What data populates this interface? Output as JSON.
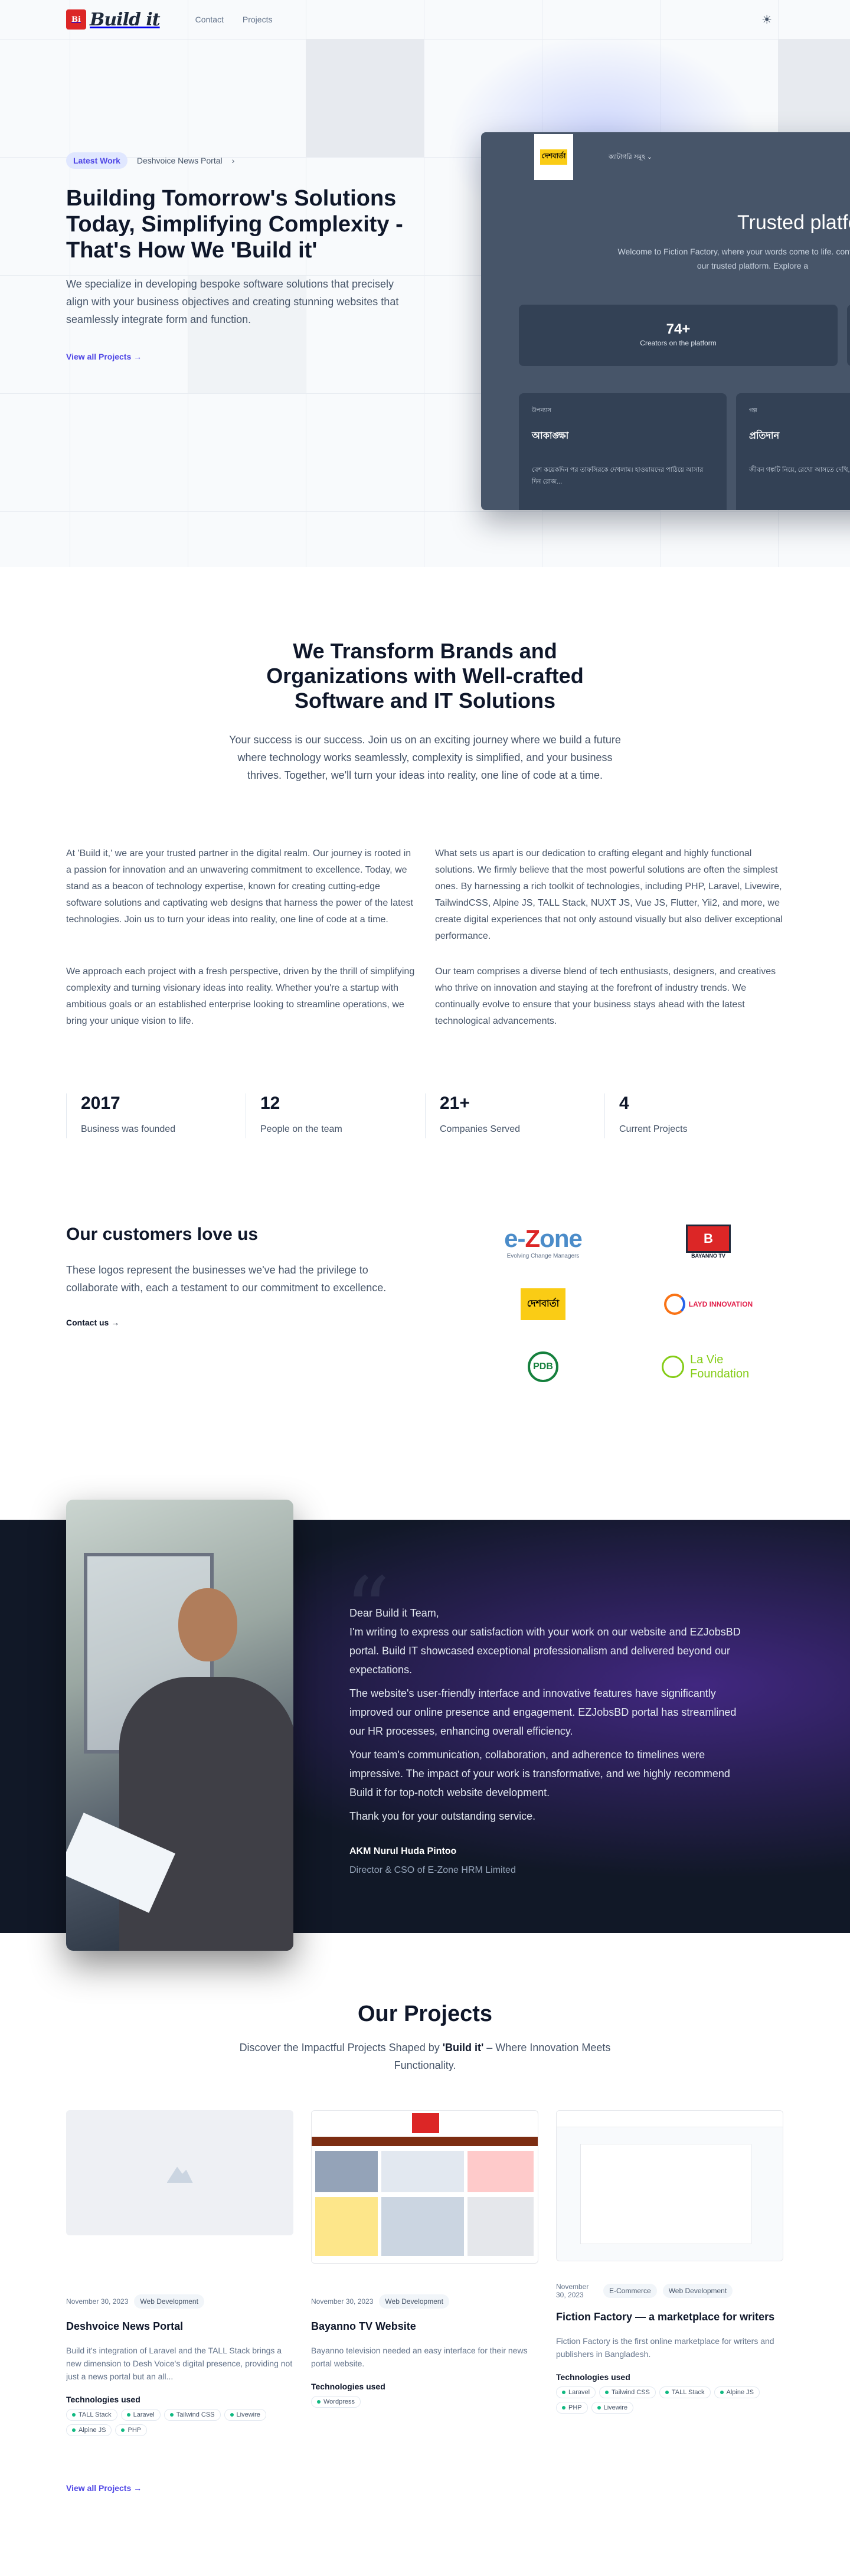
{
  "nav": {
    "logo_mark": "Bi",
    "logo_text": "Build it",
    "links": [
      "Contact",
      "Projects"
    ],
    "theme_icon": "☀"
  },
  "hero": {
    "pill": "Latest Work",
    "pill_link": "Deshvoice News Portal",
    "title": "Building Tomorrow's Solutions Today, Simplifying Complexity - That's How We 'Build it'",
    "description": "We specialize in developing bespoke software solutions that precisely align with your business objectives and creating stunning websites that seamlessly integrate form and function.",
    "cta": "View all Projects →",
    "mock": {
      "logo_text": "দেশবার্তা",
      "nav_text": "ক্যাটাগরি সমূহ ⌄",
      "title": "Trusted platform",
      "subtitle": "Welcome to Fiction Factory, where your words come to life. confidence on our trusted platform. Explore a",
      "stat_value": "74+",
      "stat_label": "Creators on the platform",
      "cards": [
        {
          "tag": "উপন্যাস",
          "title": "আকাঙ্ক্ষা",
          "text": "বেশ কয়েকদিন পর তাফসিরকে দেখলাম। হাওয়ায়দের পাঠিয়ে আসার দিন রোজ..."
        },
        {
          "tag": "গল্প",
          "title": "প্রতিদান",
          "text": "জীবন গল্পটি নিয়ে, রেখো আসতে দেখি, ওবোদের ঘুরতে সুরুজ"
        }
      ]
    }
  },
  "transform": {
    "title": "We Transform Brands and Organizations with Well-crafted Software and IT Solutions",
    "subtitle": "Your success is our success. Join us on an exciting journey where we build a future where technology works seamlessly, complexity is simplified, and your business thrives. Together, we'll turn your ideas into reality, one line of code at a time.",
    "paragraphs": [
      "At 'Build it,' we are your trusted partner in the digital realm. Our journey is rooted in a passion for innovation and an unwavering commitment to excellence. Today, we stand as a beacon of technology expertise, known for creating cutting-edge software solutions and captivating web designs that harness the power of the latest technologies. Join us to turn your ideas into reality, one line of code at a time.",
      "What sets us apart is our dedication to crafting elegant and highly functional solutions. We firmly believe that the most powerful solutions are often the simplest ones. By harnessing a rich toolkit of technologies, including PHP, Laravel, Livewire, TailwindCSS, Alpine JS, TALL Stack, NUXT JS, Vue JS, Flutter, Yii2, and more, we create digital experiences that not only astound visually but also deliver exceptional performance.",
      "We approach each project with a fresh perspective, driven by the thrill of simplifying complexity and turning visionary ideas into reality. Whether you're a startup with ambitious goals or an established enterprise looking to streamline operations, we bring your unique vision to life.",
      "Our team comprises a diverse blend of tech enthusiasts, designers, and creatives who thrive on innovation and staying at the forefront of industry trends. We continually evolve to ensure that your business stays ahead with the latest technological advancements."
    ]
  },
  "stats": [
    {
      "value": "2017",
      "label": "Business was founded"
    },
    {
      "value": "12",
      "label": "People on the team"
    },
    {
      "value": "21+",
      "label": "Companies Served"
    },
    {
      "value": "4",
      "label": "Current Projects"
    }
  ],
  "customers": {
    "title": "Our customers love us",
    "description": "These logos represent the businesses we've had the privilege to collaborate with, each a testament to our commitment to excellence.",
    "cta": "Contact us →",
    "logos": {
      "ezone_a": "e-",
      "ezone_b": "Z",
      "ezone_c": "one",
      "ezone_tag": "Evolving Change Managers",
      "bayanno": "B",
      "bayanno_sub": "BAYANNO TV",
      "desh": "দেশবার্তা",
      "layd": "LAYD INNOVATION",
      "pdb": "PDB",
      "lavie": "La Vie Foundation"
    }
  },
  "testimonial": {
    "quote_mark": "“",
    "paragraphs": [
      "Dear Build it Team,",
      "I'm writing to express our satisfaction with your work on our website and EZJobsBD portal. Build IT showcased exceptional professionalism and delivered beyond our expectations.",
      "The website's user-friendly interface and innovative features have significantly improved our online presence and engagement. EZJobsBD portal has streamlined our HR processes, enhancing overall efficiency.",
      "Your team's communication, collaboration, and adherence to timelines were impressive. The impact of your work is transformative, and we highly recommend Build it for top-notch website development.",
      "Thank you for your outstanding service."
    ],
    "author": "AKM Nurul Huda Pintoo",
    "role": "Director & CSO of E-Zone HRM Limited"
  },
  "projects": {
    "title": "Our Projects",
    "subtitle_before": "Discover the Impactful Projects Shaped by ",
    "subtitle_brand": "'Build it'",
    "subtitle_after": " – Where Innovation Meets Functionality.",
    "tech_label": "Technologies used",
    "items": [
      {
        "date": "November 30, 2023",
        "tags": [
          "Web Development"
        ],
        "title": "Deshvoice News Portal",
        "description": "Build it's integration of Laravel and the TALL Stack brings a new dimension to Desh Voice's digital presence, providing not just a news portal but an all...",
        "techs": [
          "TALL Stack",
          "Laravel",
          "Tailwind CSS",
          "Livewire",
          "Alpine JS",
          "PHP"
        ]
      },
      {
        "date": "November 30, 2023",
        "tags": [
          "Web Development"
        ],
        "title": "Bayanno TV Website",
        "description": "Bayanno television needed an easy interface for their news portal website.",
        "techs": [
          "Wordpress"
        ]
      },
      {
        "date": "November 30, 2023",
        "tags": [
          "E-Commerce",
          "Web Development"
        ],
        "title": "Fiction Factory — a marketplace for writers",
        "description": "Fiction Factory is the first online marketplace for writers and publishers in Bangladesh.",
        "techs": [
          "Laravel",
          "Tailwind CSS",
          "TALL Stack",
          "Alpine JS",
          "PHP",
          "Livewire"
        ]
      }
    ],
    "cta": "View all Projects →"
  }
}
